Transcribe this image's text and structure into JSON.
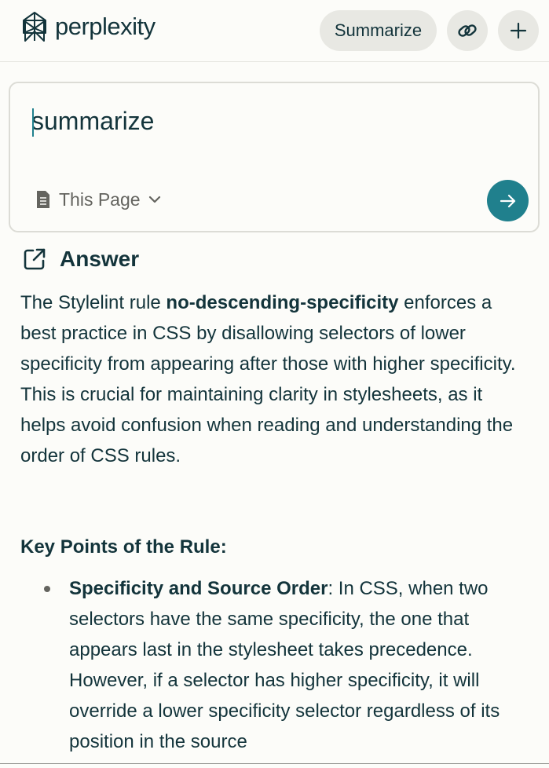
{
  "header": {
    "brand": "perplexity",
    "summarize_label": "Summarize",
    "link_icon": "link-icon",
    "plus_icon": "plus-icon"
  },
  "ask": {
    "query": "summarize",
    "scope_label": "This Page",
    "scope_icon": "document-icon",
    "send_icon": "arrow-right-icon"
  },
  "answer": {
    "title": "Answer",
    "icon": "external-link-icon",
    "intro_before": "The Stylelint rule ",
    "intro_bold": "no-descending-specificity",
    "intro_after": " enforces a best practice in CSS by disallowing selectors of lower specificity from appearing after those with higher specificity. This is crucial for maintaining clarity in stylesheets, as it helps avoid confusion when reading and understanding the order of CSS rules.",
    "section_title": "Key Points of the Rule:",
    "points": [
      {
        "bold": "Specificity and Source Order",
        "text": ": In CSS, when two selectors have the same specificity, the one that appears last in the stylesheet takes precedence. However, if a selector has higher specificity, it will override a lower specificity selector regardless of its position in the source"
      }
    ]
  },
  "colors": {
    "accent": "#20808d",
    "text": "#13343b",
    "background": "#fcfcf9",
    "pill": "#e8e8e3"
  }
}
